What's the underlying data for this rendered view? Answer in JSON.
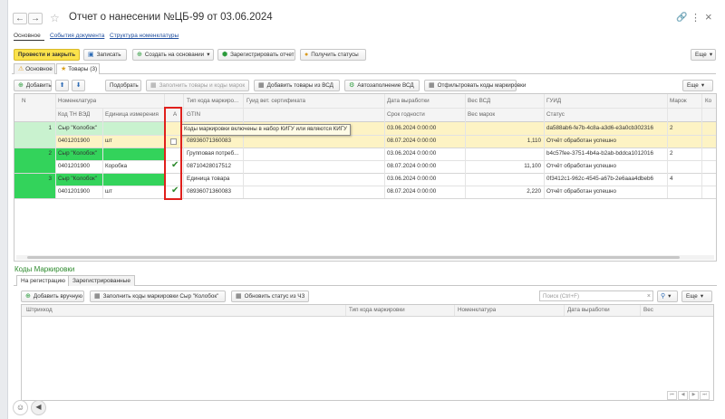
{
  "window": {
    "title": "Отчет о нанесении №ЦБ-99 от 03.06.2024",
    "menu_glyph": "⋮",
    "link_glyph": "🔗",
    "close_glyph": "×"
  },
  "nav": {
    "back": "←",
    "forward": "→",
    "star": "☆"
  },
  "top_tabs": [
    "Основное",
    "События документа",
    "Структура номенклатуры"
  ],
  "toolbar": {
    "post_close": "Провести и закрыть",
    "save": "Записать",
    "create_based": "Создать на основании",
    "register": "Зарегистрировать отчет",
    "get_status": "Получить статусы",
    "more": "Еще"
  },
  "inner_tabs": [
    "Основное",
    "Товары (3)"
  ],
  "goods_toolbar": {
    "add": "Добавить",
    "pick": "Подобрать",
    "fill_codes": "Заполнить товары и коды марок",
    "add_from_vsd": "Добавить товары из ВСД",
    "auto_vsd": "Автозаполнение ВСД",
    "select_codes": "Отфильтровать коды маркировки",
    "more": "Еще"
  },
  "goods_headers": {
    "row1": [
      "N",
      "Номенклатура",
      "А",
      "Тип кода маркиро...",
      "Гуид вет. сертификата",
      "Дата выработки",
      "Вес ВСД",
      "ГУИД",
      "Марок",
      "Ко"
    ],
    "row2": [
      "Код ТН ВЭД",
      "Единица измерения",
      "GTIN",
      "Срок годности",
      "Вес марок",
      "Статус"
    ]
  },
  "goods_rows": [
    {
      "n": "1",
      "name": "Сыр \"Колобок\"",
      "tnved": "0401201900",
      "unit": "шт",
      "checked": false,
      "type": "",
      "gtin": "08936071360083",
      "date": "03.06.2024 0:00:00",
      "expiry": "08.07.2024 0:00:00",
      "vsd_weight": "",
      "marks_weight": "1,110",
      "guid": "da588ab6-fe7b-4c8a-a3d6-e3a0cb302316",
      "status": "Отчёт обработан успешно",
      "marks": "2"
    },
    {
      "n": "2",
      "name": "Сыр \"Колобок\"",
      "tnved": "0401201900",
      "unit": "Коробка",
      "checked": true,
      "type": "Групповая потреб...",
      "gtin": "08710428017512",
      "date": "03.06.2024 0:00:00",
      "expiry": "08.07.2024 0:00:00",
      "vsd_weight": "",
      "marks_weight": "11,100",
      "guid": "b4c57fee-3751-4b4a-b2ab-bddca1012016",
      "status": "Отчёт обработан успешно",
      "marks": "2"
    },
    {
      "n": "3",
      "name": "Сыр \"Колобок\"",
      "tnved": "0401201900",
      "unit": "шт",
      "checked": true,
      "type": "Единица товара",
      "gtin": "08936071360083",
      "date": "03.06.2024 0:00:00",
      "expiry": "08.07.2024 0:00:00",
      "vsd_weight": "",
      "marks_weight": "2,220",
      "guid": "0f3412c1-962c-4545-a67b-2e6aaa4dbeb6",
      "status": "Отчёт обработан успешно",
      "marks": "4"
    }
  ],
  "tooltip": "Коды маркировки включены в набор КИГУ или являются КИГУ",
  "codes_section": {
    "title": "Коды Маркировки",
    "tabs": [
      "На регистрацию",
      "Зарегистрированные"
    ],
    "add_manual": "Добавить вручную",
    "fill_codes": "Заполнить коды маркировки Сыр \"Колобок\"",
    "update_status": "Обновить статус из ЧЗ",
    "search_placeholder": "Поиск (Ctrl+F)",
    "more": "Еще",
    "headers": [
      "Штрихкод",
      "Тип кода маркировки",
      "Номенклатура",
      "Дата выработки",
      "Вес"
    ]
  },
  "colors": {
    "accent_yellow": "#fbe24b",
    "row_green": "#33d35b",
    "row_light_green": "#c9f2cf",
    "row_yellow": "#fdf3c4",
    "highlight_red": "#e0201c"
  }
}
